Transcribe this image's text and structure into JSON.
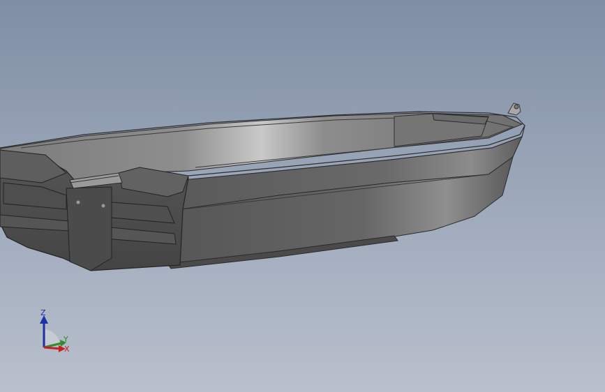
{
  "triad": {
    "z_label": "Z",
    "y_label": "Y",
    "x_label": "X",
    "z_color": "#1f2fa8",
    "y_color": "#2e8b2e",
    "x_color": "#c42020"
  },
  "model": {
    "name": "boat-hull",
    "hull_color": "#5f5f5f",
    "interior_color": "#8a8a8a"
  }
}
